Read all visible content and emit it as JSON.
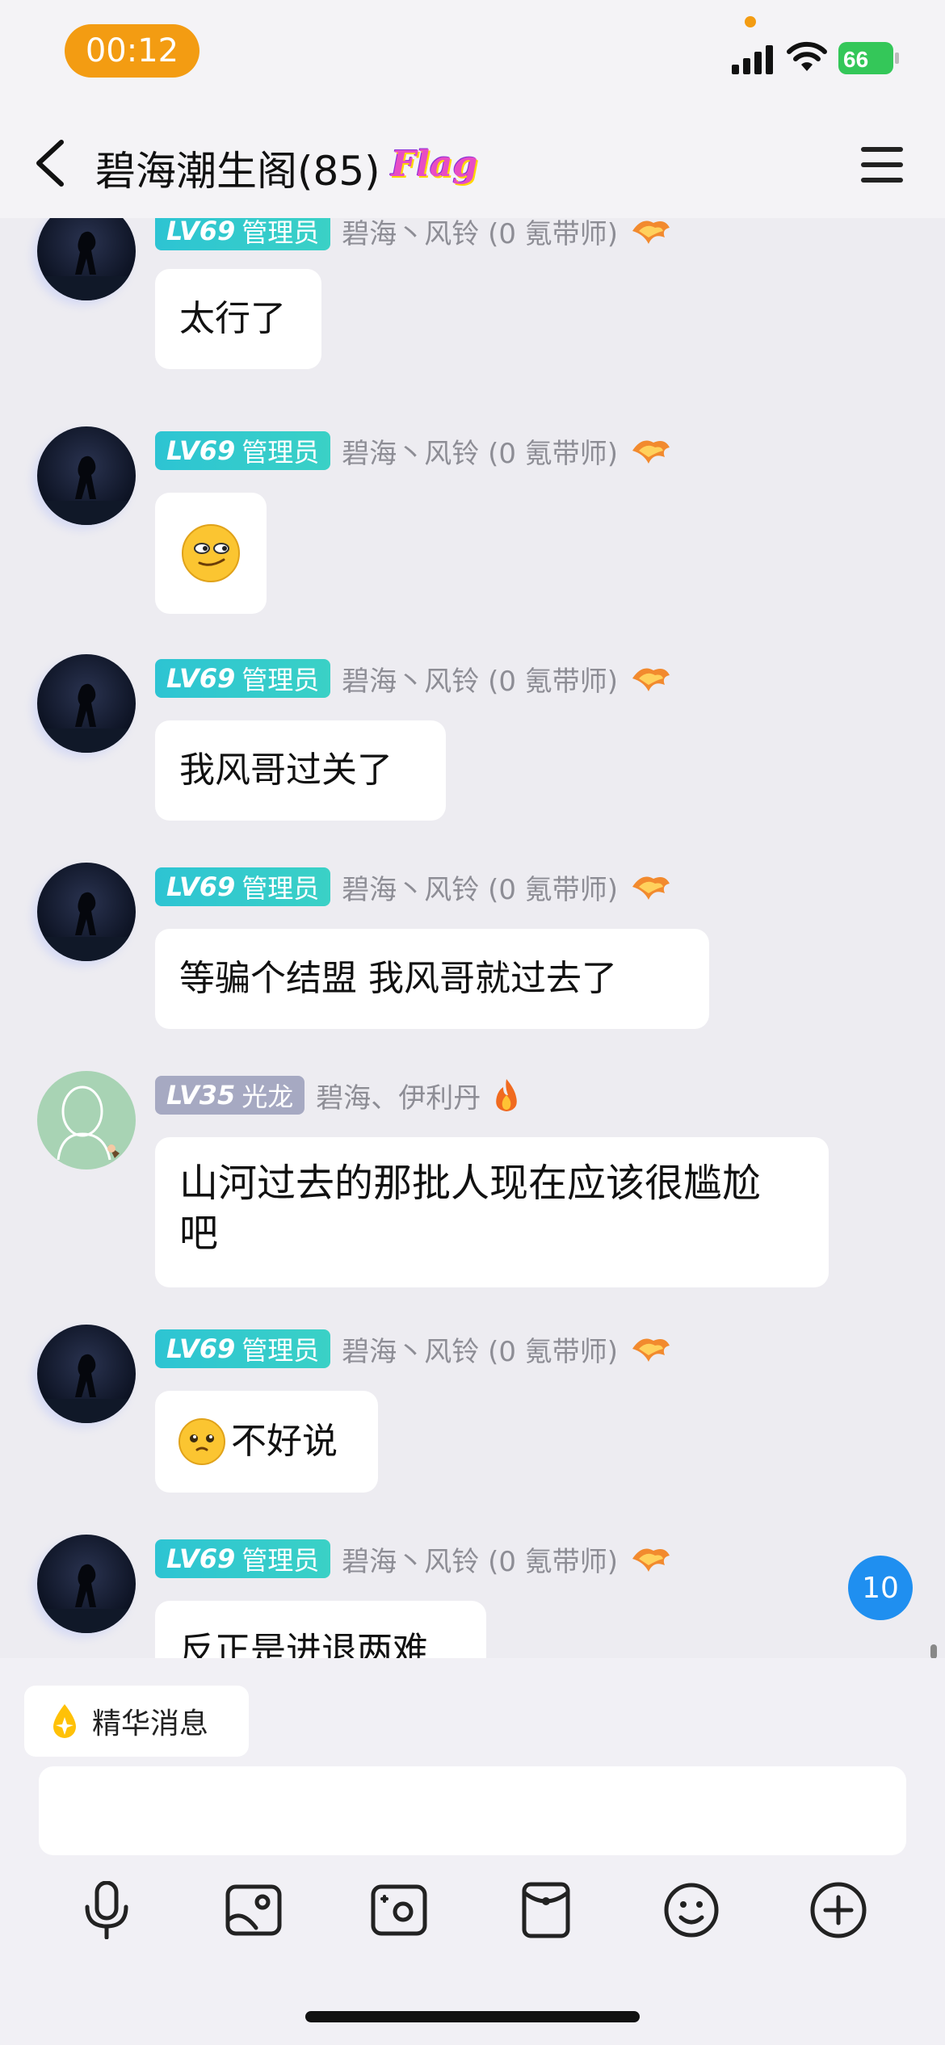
{
  "status_bar": {
    "time": "00:12",
    "battery": "66"
  },
  "header": {
    "title": "碧海潮生阁(85)",
    "flag": "Flag"
  },
  "messages": [
    {
      "level": "LV69",
      "role": "管理员",
      "sender": "碧海丶风铃 (0 氪带师)",
      "text": "太行了"
    },
    {
      "level": "LV69",
      "role": "管理员",
      "sender": "碧海丶风铃 (0 氪带师)",
      "emoji": "smirk-emoji"
    },
    {
      "level": "LV69",
      "role": "管理员",
      "sender": "碧海丶风铃 (0 氪带师)",
      "text": "我风哥过关了"
    },
    {
      "level": "LV69",
      "role": "管理员",
      "sender": "碧海丶风铃 (0 氪带师)",
      "text": "等骗个结盟 我风哥就过去了"
    },
    {
      "level": "LV35",
      "role": "光龙",
      "sender": "碧海、伊利丹",
      "text": "山河过去的那批人现在应该很尴尬\n吧"
    },
    {
      "level": "LV69",
      "role": "管理员",
      "sender": "碧海丶风铃 (0 氪带师)",
      "text": "不好说"
    },
    {
      "level": "LV69",
      "role": "管理员",
      "sender": "碧海丶风铃 (0 氪带师)",
      "text": "反正是进退两难"
    }
  ],
  "unread_count": "10",
  "bottom": {
    "highlight_label": "精华消息"
  },
  "colors": {
    "accent": "#1f8ff0",
    "time_pill": "#f39c12",
    "admin_badge": "#2dc4d3"
  }
}
